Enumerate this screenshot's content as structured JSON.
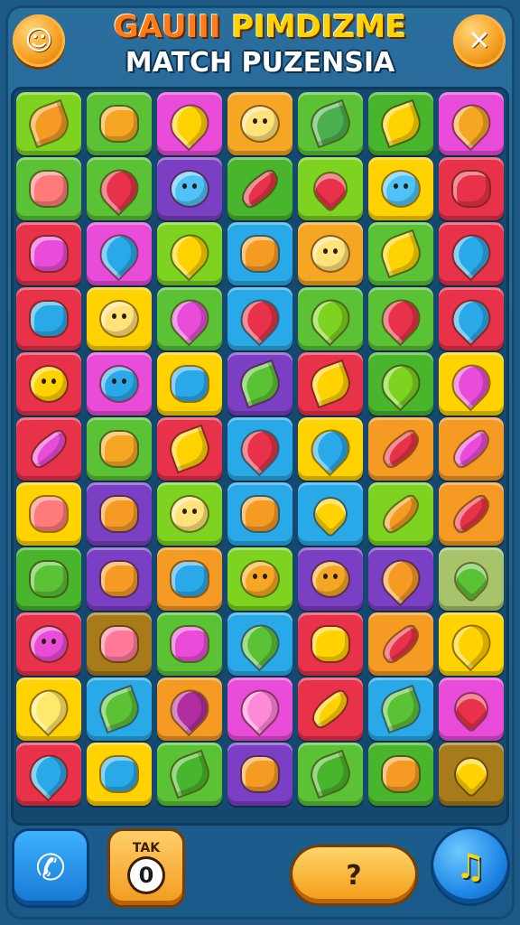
{
  "header": {
    "title_line1_part1": "GAUIII",
    "title_line1_part2": "PIMDIZME",
    "title_line2": "MATCH PUZENSIA",
    "left_button_glyph": "☺",
    "close_button_glyph": "✕"
  },
  "board": {
    "rows": 11,
    "cols": 7,
    "tiles": [
      [
        "#7ed321:#f59a23:leaf",
        "#5bc236:#f5a623:spiky",
        "#e94cd8:#ffd200:drop",
        "#f5a623:#ffe27a:face",
        "#5bc236:#4caf50:leaf",
        "#49b52c:#ffd200:leaf",
        "#e94cd8:#f5a623:drop"
      ],
      [
        "#5bc236:#ff7a7a:spiky",
        "#5bc236:#e8324a:drop",
        "#7b3fc4:#4fc3f7:face",
        "#49b52c:#e8324a:pepper",
        "#7ed321:#e8324a:heart",
        "#ffd200:#4fc3f7:face",
        "#e8324a:#e8324a:spiky"
      ],
      [
        "#e8324a:#e94cd8:spiky",
        "#e94cd8:#29a9e8:drop",
        "#7ed321:#ffd200:drop",
        "#29a9e8:#f59a23:spiky",
        "#f5a623:#ffe27a:face",
        "#5bc236:#ffd200:leaf",
        "#e8324a:#29a9e8:drop"
      ],
      [
        "#e8324a:#29a9e8:spiky",
        "#ffd200:#ffe27a:face",
        "#5bc236:#e94cd8:drop",
        "#29a9e8:#e8324a:drop",
        "#5bc236:#7ed321:drop",
        "#5bc236:#e8324a:drop",
        "#e8324a:#29a9e8:drop"
      ],
      [
        "#e8324a:#ffd200:face",
        "#e94cd8:#29a9e8:face",
        "#ffd200:#29a9e8:spiky",
        "#7b3fc4:#5bc236:leaf",
        "#e8324a:#ffd200:leaf",
        "#49b52c:#7ed321:drop",
        "#ffd200:#e94cd8:drop"
      ],
      [
        "#e8324a:#e94cd8:pepper",
        "#5bc236:#f5a623:spiky",
        "#e8324a:#ffd200:leaf",
        "#29a9e8:#e8324a:drop",
        "#ffd200:#29a9e8:drop",
        "#f59a23:#e8324a:pepper",
        "#f59a23:#e94cd8:pepper"
      ],
      [
        "#ffd200:#ff7a7a:spiky",
        "#7b3fc4:#f59a23:spiky",
        "#7ed321:#ffe27a:face",
        "#29a9e8:#f59a23:spiky",
        "#29a9e8:#ffd200:heart",
        "#7ed321:#f59a23:pepper",
        "#f59a23:#e8324a:pepper"
      ],
      [
        "#49b52c:#5bc236:spiky",
        "#7b3fc4:#f59a23:spiky",
        "#f59a23:#29a9e8:spiky",
        "#7ed321:#f5a623:face",
        "#7b3fc4:#f5a623:face",
        "#7b3fc4:#f59a23:drop",
        "#a7c46a:#5bc236:heart"
      ],
      [
        "#e8324a:#e94cd8:face",
        "#a77a1a:#ff7a9a:spiky",
        "#5bc236:#e94cd8:spiky",
        "#29a9e8:#5bc236:drop",
        "#e8324a:#ffd200:spiky",
        "#f59a23:#e8324a:pepper",
        "#ffd200:#ffd200:drop"
      ],
      [
        "#ffd200:#ffe96a:drop",
        "#29a9e8:#5bc236:leaf",
        "#f59a23:#b02ea0:drop",
        "#e94cd8:#ff8ad8:drop",
        "#e8324a:#ffd200:pepper",
        "#29a9e8:#5bc236:leaf",
        "#e94cd8:#e8324a:heart"
      ],
      [
        "#e8324a:#29a9e8:drop",
        "#ffd200:#29a9e8:spiky",
        "#5bc236:#49b52c:leaf",
        "#7b3fc4:#f59a23:spiky",
        "#5bc236:#49b52c:leaf",
        "#49b52c:#f59a23:spiky",
        "#a77a1a:#ffd200:heart"
      ]
    ]
  },
  "footer": {
    "phone_glyph": "✆",
    "tak_label": "TAK",
    "tak_value": "0",
    "hint_label": "?",
    "music_glyph": "♫"
  }
}
